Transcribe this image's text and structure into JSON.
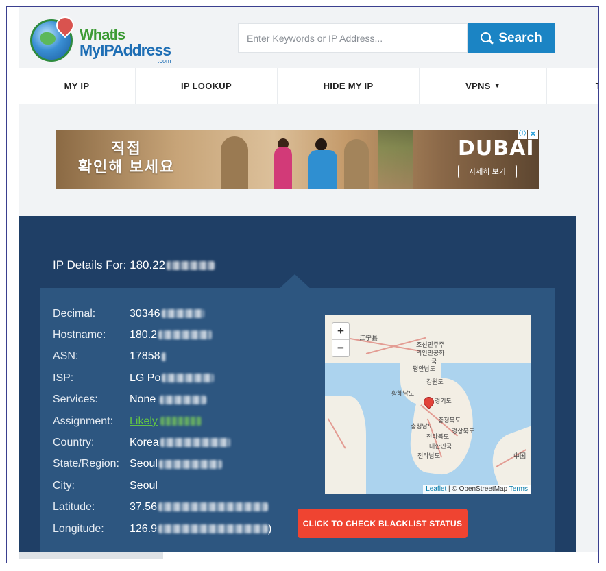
{
  "header": {
    "logo": {
      "line1": "WhatIs",
      "line2": "MyIPAddress",
      "suffix": ".com"
    },
    "search": {
      "placeholder": "Enter Keywords or IP Address...",
      "button_label": "Search"
    }
  },
  "nav": {
    "items": [
      {
        "label": "MY IP"
      },
      {
        "label": "IP LOOKUP"
      },
      {
        "label": "HIDE MY IP"
      },
      {
        "label": "VPNS",
        "caret": "▼"
      },
      {
        "label": "T"
      }
    ]
  },
  "ad": {
    "headline": "직접\n확인해 보세요",
    "brand": "DUBAI",
    "cta": "자세히 보기",
    "info_icon": "ⓘ",
    "close_icon": "✕"
  },
  "details": {
    "title_prefix": "IP Details For: 180.22",
    "rows": [
      {
        "label": "Decimal:",
        "value": "30346"
      },
      {
        "label": "Hostname:",
        "value": "180.2"
      },
      {
        "label": "ASN:",
        "value": "17858"
      },
      {
        "label": "ISP:",
        "value": "LG Po"
      },
      {
        "label": "Services:",
        "value": "None"
      },
      {
        "label": "Assignment:",
        "value": "Likely"
      },
      {
        "label": "Country:",
        "value": "Korea"
      },
      {
        "label": "State/Region:",
        "value": "Seoul"
      },
      {
        "label": "City:",
        "value": "Seoul"
      },
      {
        "label": "Latitude:",
        "value": "37.56"
      },
      {
        "label": "Longitude:",
        "value": "126.9",
        "trailing": ")"
      }
    ],
    "map": {
      "zoom_in": "+",
      "zoom_out": "−",
      "labels": [
        "江宁县",
        "조선민주주",
        "의인민공화",
        "국",
        "강원도",
        "평안남도",
        "황해남도",
        "경기도",
        "충청북도",
        "충청남도",
        "전라북도",
        "대한민국",
        "경상북도",
        "전라남도",
        "中国"
      ],
      "attribution": {
        "leaflet": "Leaflet",
        "separator": " | © OpenStreetMap ",
        "terms": "Terms"
      }
    },
    "blacklist_button": "CLICK TO CHECK BLACKLIST STATUS"
  }
}
